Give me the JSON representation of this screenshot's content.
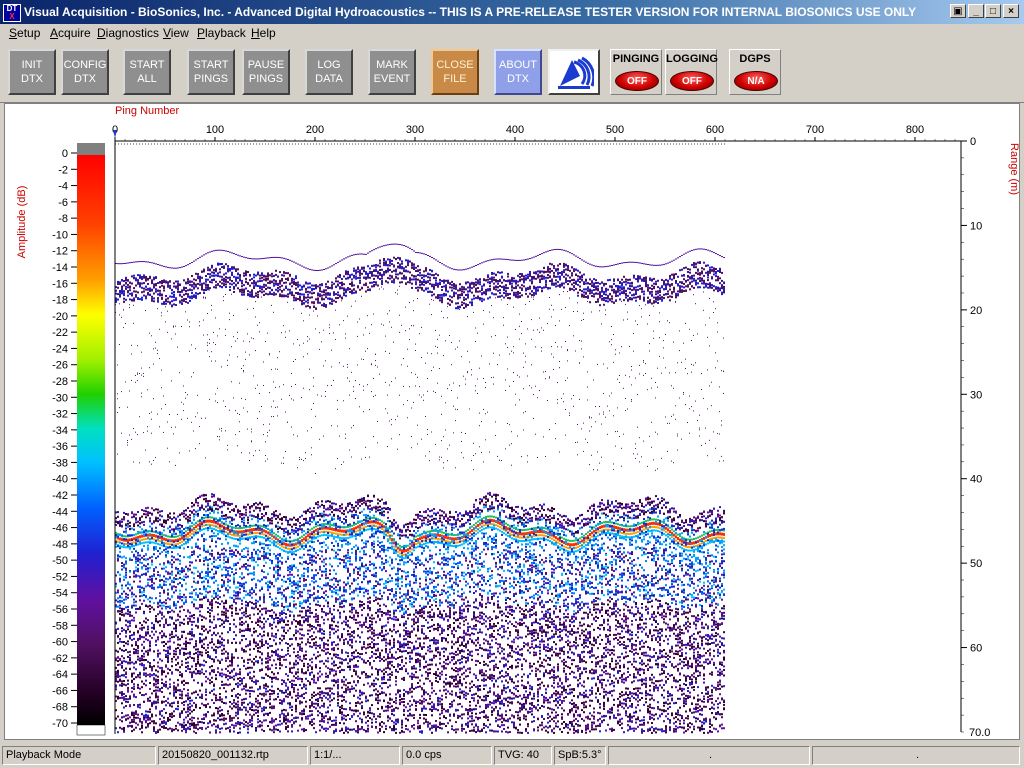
{
  "window": {
    "icon_text": "DT",
    "icon_sub": "X",
    "title": "Visual Acquisition  -  BioSonics, Inc.  -  Advanced Digital Hydroacoustics  -- THIS IS A PRE-RELEASE TESTER VERSION FOR INTERNAL BIOSONICS USE ONLY",
    "restore_glyph": "▣",
    "minimize_glyph": "_",
    "maximize_glyph": "□",
    "close_glyph": "×"
  },
  "menu": [
    "Setup",
    "Acquire",
    "Diagnostics",
    "View",
    "Playback",
    "Help"
  ],
  "toolbar": {
    "buttons": [
      {
        "name": "init-dtx-button",
        "label": "INIT\nDTX"
      },
      {
        "name": "config-dtx-button",
        "label": "CONFIG\nDTX"
      },
      {
        "name": "start-all-button",
        "label": "START\nALL"
      },
      {
        "name": "start-pings-button",
        "label": "START\nPINGS"
      },
      {
        "name": "pause-pings-button",
        "label": "PAUSE\nPINGS"
      },
      {
        "name": "log-data-button",
        "label": "LOG\nDATA"
      },
      {
        "name": "mark-event-button",
        "label": "MARK\nEVENT"
      },
      {
        "name": "close-file-button",
        "label": "CLOSE\nFILE"
      },
      {
        "name": "about-dtx-button",
        "label": "ABOUT\nDTX"
      }
    ],
    "indicators": [
      {
        "name": "pinging-indicator",
        "label": "PINGING",
        "state": "OFF"
      },
      {
        "name": "logging-indicator",
        "label": "LOGGING",
        "state": "OFF"
      },
      {
        "name": "dgps-indicator",
        "label": "DGPS",
        "state": "N/A"
      }
    ]
  },
  "echogram": {
    "x_axis_label": "Ping Number",
    "x_ticks": [
      0,
      100,
      200,
      300,
      400,
      500,
      600,
      700,
      800
    ],
    "x_max": 845,
    "y_axis_label": "Range (m)",
    "y_ticks": [
      0,
      10,
      20,
      30,
      40,
      50,
      60
    ],
    "y_bottom_label": "70.0",
    "y_max": 70,
    "color_scale_label": "Amplitude (dB)",
    "color_scale_ticks": [
      0,
      -2,
      -4,
      -6,
      -8,
      -10,
      -12,
      -14,
      -16,
      -18,
      -20,
      -22,
      -24,
      -26,
      -28,
      -30,
      -32,
      -34,
      -36,
      -38,
      -40,
      -42,
      -44,
      -46,
      -48,
      -50,
      -52,
      -54,
      -56,
      -58,
      -60,
      -62,
      -64,
      -66,
      -68,
      -70
    ],
    "pings_recorded": 610,
    "bottom_depth_m": 46.5,
    "surface_layer_depth_m": 15.5,
    "colors": {
      "axis_label": "#cc0000"
    }
  },
  "status_bar": [
    "Playback Mode",
    "20150820_001132.rtp",
    "1:1/...",
    "0.0 cps",
    "TVG: 40",
    "SpB:5.3°",
    ".",
    "."
  ]
}
